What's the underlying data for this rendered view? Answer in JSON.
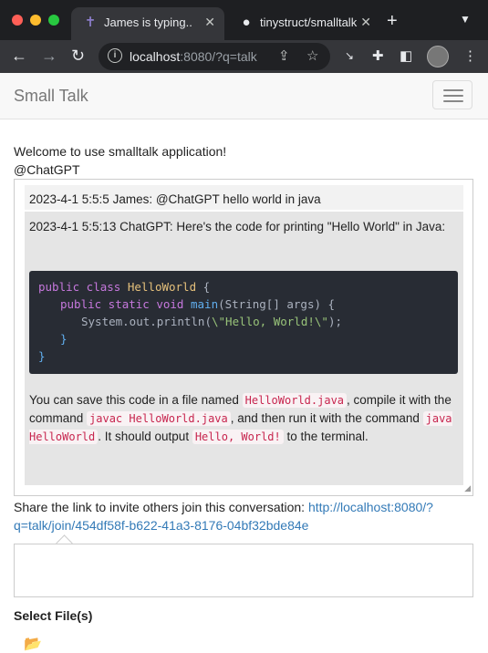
{
  "browser": {
    "tabs": [
      {
        "label": "James is typing..",
        "icon": "cross-icon",
        "active": true
      },
      {
        "label": "tinystruct/smalltalk",
        "icon": "github-icon",
        "active": false
      }
    ],
    "new_tab": "+",
    "url_host": "localhost",
    "url_rest": ":8080/?q=talk"
  },
  "app": {
    "brand": "Small Talk",
    "welcome": "Welcome to use smalltalk application!",
    "mention": "@ChatGPT",
    "messages": [
      {
        "text": "2023-4-1 5:5:5 James: @ChatGPT hello world in java"
      },
      {
        "intro": "2023-4-1 5:5:13 ChatGPT: Here's the code for printing \"Hello World\" in Java:",
        "code": {
          "line1_kw": "public class ",
          "line1_cls": "HelloWorld",
          "line1_end": " {",
          "line2_kw": "public static void ",
          "line2_fn": "main",
          "line2_end": "(String[] args) {",
          "line3_pre": "System.out.println(",
          "line3_str": "\\\"Hello, World!\\\"",
          "line3_end": ");",
          "line4": "}",
          "line5": "}"
        },
        "outro_1": "You can save this code in a file named ",
        "file": "HelloWorld.java",
        "outro_2": ", compile it with the command ",
        "compile_cmd": "javac HelloWorld.java",
        "outro_3": ", and then run it with the command ",
        "run_cmd": "java HelloWorld",
        "outro_4": ". It should output ",
        "output": "Hello, World!",
        "outro_5": " to the terminal."
      }
    ],
    "share_text": "Share the link to invite others join this conversation: ",
    "share_link": "http://localhost:8080/?q=talk/join/454df58f-b622-41a3-8176-04bf32bde84e",
    "select_files": "Select File(s)"
  },
  "colors": {
    "link": "#337ab7",
    "code_bg": "#282c34",
    "inline_code": "#c7254e"
  }
}
